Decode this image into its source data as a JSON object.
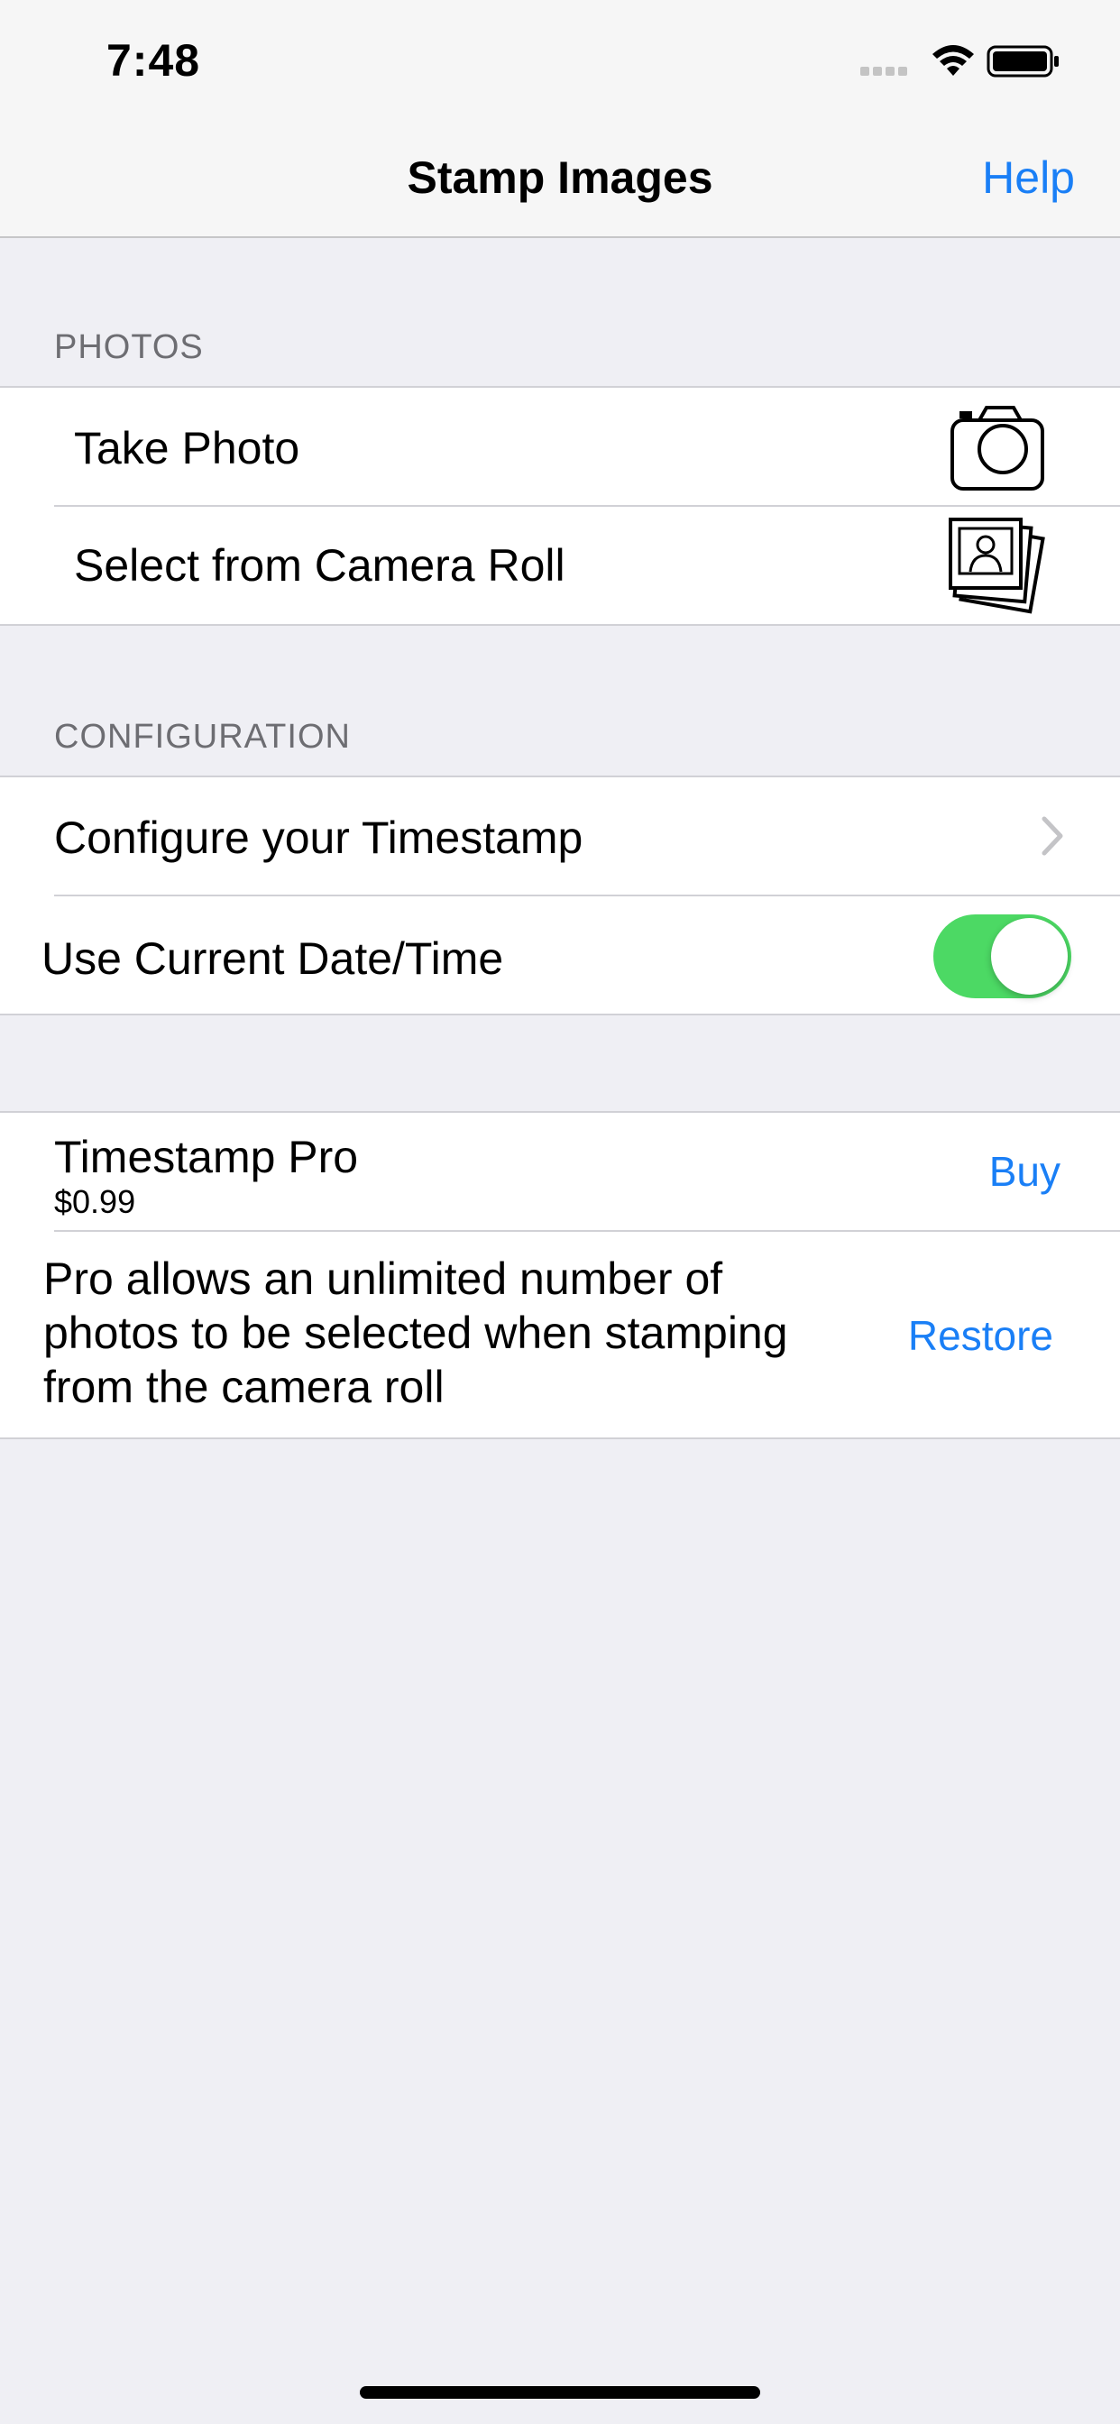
{
  "status_bar": {
    "time": "7:48",
    "icons": [
      "signal-icon",
      "wifi-icon",
      "battery-icon"
    ]
  },
  "nav": {
    "title": "Stamp Images",
    "help_label": "Help"
  },
  "photos_section": {
    "header": "PHOTOS",
    "items": [
      {
        "label": "Take Photo",
        "icon": "camera-icon"
      },
      {
        "label": "Select from Camera Roll",
        "icon": "photo-stack-icon"
      }
    ]
  },
  "configuration_section": {
    "header": "CONFIGURATION",
    "configure_label": "Configure your Timestamp",
    "use_current_label": "Use Current Date/Time",
    "use_current_on": true
  },
  "pro_section": {
    "title": "Timestamp Pro",
    "price": "$0.99",
    "buy_label": "Buy",
    "description_lines": [
      "Pro allows an unlimited number of",
      "photos to be selected when stamping",
      "from the camera roll"
    ],
    "restore_label": "Restore"
  },
  "colors": {
    "accent": "#1a7ff6",
    "toggle_on": "#4cd964",
    "background": "#efeff4"
  }
}
